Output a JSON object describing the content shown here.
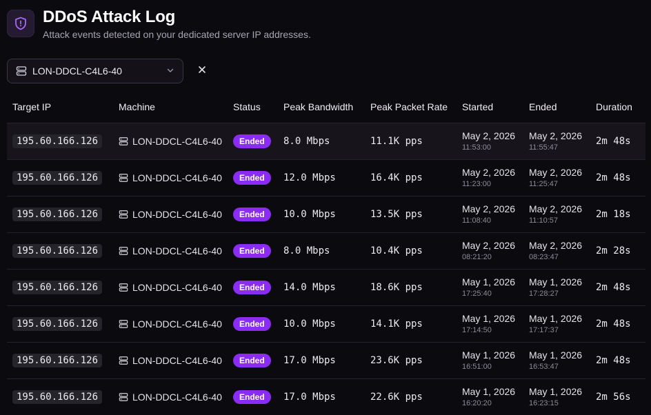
{
  "header": {
    "title": "DDoS Attack Log",
    "subtitle": "Attack events detected on your dedicated server IP addresses."
  },
  "filter": {
    "selected": "LON-DDCL-C4L6-40"
  },
  "columns": [
    "Target IP",
    "Machine",
    "Status",
    "Peak Bandwidth",
    "Peak Packet Rate",
    "Started",
    "Ended",
    "Duration"
  ],
  "rows": [
    {
      "ip": "195.60.166.126",
      "machine": "LON-DDCL-C4L6-40",
      "status": "Ended",
      "bandwidth": "8.0 Mbps",
      "packets": "11.1K pps",
      "start_date": "May 2, 2026",
      "start_time": "11:53:00",
      "end_date": "May 2, 2026",
      "end_time": "11:55:47",
      "duration": "2m 48s"
    },
    {
      "ip": "195.60.166.126",
      "machine": "LON-DDCL-C4L6-40",
      "status": "Ended",
      "bandwidth": "12.0 Mbps",
      "packets": "16.4K pps",
      "start_date": "May 2, 2026",
      "start_time": "11:23:00",
      "end_date": "May 2, 2026",
      "end_time": "11:25:47",
      "duration": "2m 48s"
    },
    {
      "ip": "195.60.166.126",
      "machine": "LON-DDCL-C4L6-40",
      "status": "Ended",
      "bandwidth": "10.0 Mbps",
      "packets": "13.5K pps",
      "start_date": "May 2, 2026",
      "start_time": "11:08:40",
      "end_date": "May 2, 2026",
      "end_time": "11:10:57",
      "duration": "2m 18s"
    },
    {
      "ip": "195.60.166.126",
      "machine": "LON-DDCL-C4L6-40",
      "status": "Ended",
      "bandwidth": "8.0 Mbps",
      "packets": "10.4K pps",
      "start_date": "May 2, 2026",
      "start_time": "08:21:20",
      "end_date": "May 2, 2026",
      "end_time": "08:23:47",
      "duration": "2m 28s"
    },
    {
      "ip": "195.60.166.126",
      "machine": "LON-DDCL-C4L6-40",
      "status": "Ended",
      "bandwidth": "14.0 Mbps",
      "packets": "18.6K pps",
      "start_date": "May 1, 2026",
      "start_time": "17:25:40",
      "end_date": "May 1, 2026",
      "end_time": "17:28:27",
      "duration": "2m 48s"
    },
    {
      "ip": "195.60.166.126",
      "machine": "LON-DDCL-C4L6-40",
      "status": "Ended",
      "bandwidth": "10.0 Mbps",
      "packets": "14.1K pps",
      "start_date": "May 1, 2026",
      "start_time": "17:14:50",
      "end_date": "May 1, 2026",
      "end_time": "17:17:37",
      "duration": "2m 48s"
    },
    {
      "ip": "195.60.166.126",
      "machine": "LON-DDCL-C4L6-40",
      "status": "Ended",
      "bandwidth": "17.0 Mbps",
      "packets": "23.6K pps",
      "start_date": "May 1, 2026",
      "start_time": "16:51:00",
      "end_date": "May 1, 2026",
      "end_time": "16:53:47",
      "duration": "2m 48s"
    },
    {
      "ip": "195.60.166.126",
      "machine": "LON-DDCL-C4L6-40",
      "status": "Ended",
      "bandwidth": "17.0 Mbps",
      "packets": "22.6K pps",
      "start_date": "May 1, 2026",
      "start_time": "16:20:20",
      "end_date": "May 1, 2026",
      "end_time": "16:23:15",
      "duration": "2m 56s"
    }
  ],
  "colors": {
    "accent": "#8b2cf5",
    "background": "#0b0a0e"
  }
}
